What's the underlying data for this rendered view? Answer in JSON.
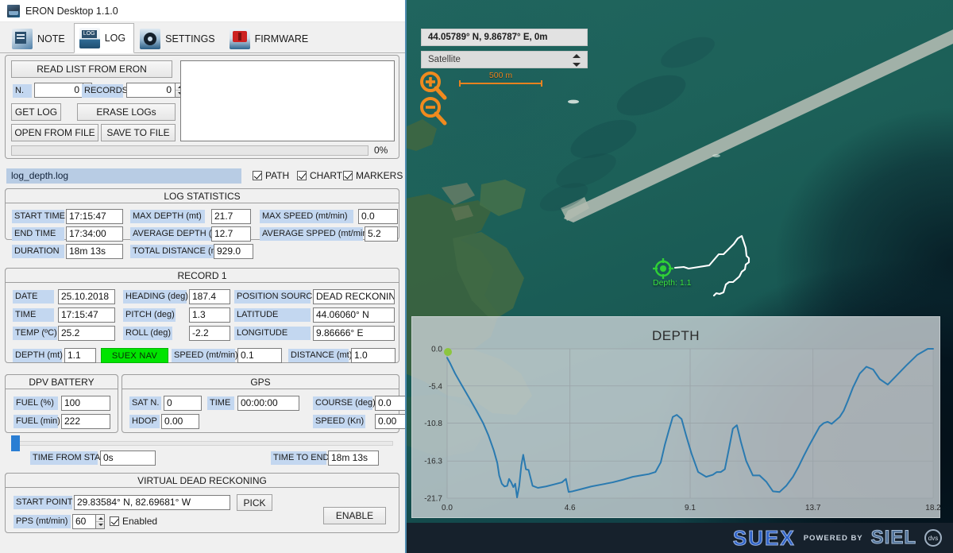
{
  "window": {
    "title": "ERON Desktop 1.1.0",
    "app_icon": "eron-app-icon",
    "minimize": "minimize-icon",
    "maximize": "maximize-icon",
    "close": "close-icon"
  },
  "tabs": [
    {
      "label": "NOTE",
      "icon": "note-icon",
      "active": false
    },
    {
      "label": "LOG",
      "icon": "log-icon",
      "active": true
    },
    {
      "label": "SETTINGS",
      "icon": "gear-icon",
      "active": false
    },
    {
      "label": "FIRMWARE",
      "icon": "firmware-icon",
      "active": false
    }
  ],
  "log_controls": {
    "read_list_button": "READ LIST FROM ERON",
    "n_label": "N.",
    "n_value": "0",
    "records_label": "RECORDS",
    "records_value": "0",
    "get_log_button": "GET LOG",
    "erase_logs_button": "ERASE LOGs",
    "open_from_file_button": "OPEN FROM FILE",
    "save_to_file_button": "SAVE TO FILE",
    "progress_percent": "0%",
    "progress_value": 0,
    "log_list_items": []
  },
  "file_row": {
    "filename": "log_depth.log",
    "checkboxes": [
      {
        "label": "PATH",
        "checked": true
      },
      {
        "label": "CHART",
        "checked": true
      },
      {
        "label": "MARKERS",
        "checked": true
      }
    ]
  },
  "log_statistics": {
    "title": "LOG STATISTICS",
    "fields": [
      {
        "label": "START TIME",
        "value": "17:15:47"
      },
      {
        "label": "END TIME",
        "value": "17:34:00"
      },
      {
        "label": "DURATION",
        "value": "18m 13s"
      },
      {
        "label": "MAX DEPTH (mt)",
        "value": "21.7"
      },
      {
        "label": "AVERAGE DEPTH (mt)",
        "value": "12.7"
      },
      {
        "label": "TOTAL DISTANCE (mt)",
        "value": "929.0"
      },
      {
        "label": "MAX SPEED (mt/min)",
        "value": "0.0"
      },
      {
        "label": "AVERAGE SPPED (mt/min)",
        "value": "5.2"
      }
    ]
  },
  "record": {
    "title": "RECORD  1",
    "date_label": "DATE",
    "date_value": "25.10.2018",
    "time_label": "TIME",
    "time_value": "17:15:47",
    "temp_label": "TEMP (ºC)",
    "temp_value": "25.2",
    "heading_label": "HEADING (deg)",
    "heading_value": "187.4",
    "pitch_label": "PITCH (deg)",
    "pitch_value": "1.3",
    "roll_label": "ROLL (deg)",
    "roll_value": "-2.2",
    "position_source_label": "POSITION SOURCE",
    "position_source_value": "DEAD RECKONING",
    "latitude_label": "LATITUDE",
    "latitude_value": "44.06060° N",
    "longitude_label": "LONGITUDE",
    "longitude_value": "9.86666° E",
    "depth_label": "DEPTH (mt)",
    "depth_value": "1.1",
    "nav_badge": "SUEX NAV",
    "speed_label": "SPEED (mt/min)",
    "speed_value": "0.1",
    "distance_label": "DISTANCE (mt)",
    "distance_value": "1.0"
  },
  "dpv_battery": {
    "title": "DPV BATTERY",
    "fuel_pct_label": "FUEL (%)",
    "fuel_pct_value": "100",
    "fuel_min_label": "FUEL (min)",
    "fuel_min_value": "222"
  },
  "gps": {
    "title": "GPS",
    "sat_label": "SAT N.",
    "sat_value": "0",
    "hdop_label": "HDOP",
    "hdop_value": "0.00",
    "time_label": "TIME",
    "time_value": "00:00:00",
    "course_label": "COURSE (deg)",
    "course_value": "0.0",
    "speed_label": "SPEED (Kn)",
    "speed_value": "0.00"
  },
  "timeline": {
    "position": 0,
    "time_from_start_label": "TIME FROM START",
    "time_from_start_value": "0s",
    "time_to_end_label": "TIME TO END",
    "time_to_end_value": "18m 13s"
  },
  "virtual_dead_reckoning": {
    "title": "VIRTUAL DEAD RECKONING",
    "start_point_label": "START POINT",
    "start_point_value": "29.83584° N, 82.69681° W",
    "pick_button": "PICK",
    "pps_label": "PPS  (mt/min)",
    "pps_value": "60",
    "enabled_label": "Enabled",
    "enabled_checked": true,
    "enable_button": "ENABLE"
  },
  "map": {
    "coords": "44.05789° N, 9.86787° E, 0m",
    "layer": "Satellite",
    "zoom_in_icon": "zoom-in-icon",
    "zoom_out_icon": "zoom-out-icon",
    "scale_label": "500 m",
    "marker_label": "Depth: 1.1",
    "track_color": "#ffffff",
    "marker_color": "#39e23f"
  },
  "brand": {
    "suex": "SUEX",
    "powered_by": "POWERED BY",
    "siel": "SIEL",
    "dot": "dvs"
  },
  "chart_data": {
    "type": "line",
    "title": "DEPTH",
    "xlabel": "",
    "ylabel": "",
    "line_color": "#2a7ab0",
    "grid": true,
    "legend": false,
    "xlim": [
      0.0,
      18.2
    ],
    "ylim": [
      -21.7,
      0.0
    ],
    "xticks": [
      0.0,
      4.6,
      9.1,
      13.7,
      18.2
    ],
    "xtick_labels": [
      "0.0",
      "4.6",
      "9.1",
      "13.7",
      "18.2"
    ],
    "yticks": [
      0.0,
      -5.4,
      -10.8,
      -16.3,
      -21.7
    ],
    "ytick_labels": [
      "0.0",
      "-5.4",
      "-10.8",
      "-16.3",
      "-21.7"
    ],
    "start_marker": {
      "x": 0.0,
      "y": 0.0,
      "color": "#8cc63f"
    },
    "series": [
      {
        "name": "Depth (mt)",
        "x": [
          0.0,
          0.1,
          0.3,
          0.55,
          0.85,
          1.1,
          1.35,
          1.55,
          1.75,
          1.88,
          1.95,
          2.05,
          2.15,
          2.25,
          2.32,
          2.4,
          2.48,
          2.55,
          2.62,
          2.7,
          2.78,
          2.85,
          2.95,
          3.05,
          3.2,
          3.4,
          3.7,
          4.0,
          4.3,
          4.45,
          4.55,
          4.7,
          5.0,
          5.4,
          5.8,
          6.2,
          6.6,
          6.95,
          7.25,
          7.55,
          7.8,
          8.0,
          8.15,
          8.3,
          8.45,
          8.6,
          8.78,
          8.95,
          9.15,
          9.4,
          9.7,
          9.95,
          10.1,
          10.25,
          10.4,
          10.55,
          10.7,
          10.85,
          11.0,
          11.2,
          11.45,
          11.7,
          11.95,
          12.2,
          12.45,
          12.7,
          12.95,
          13.15,
          13.35,
          13.55,
          13.75,
          13.95,
          14.1,
          14.25,
          14.4,
          14.55,
          14.7,
          14.85,
          15.0,
          15.2,
          15.45,
          15.7,
          15.95,
          16.2,
          16.5,
          16.8,
          17.2,
          17.6,
          18.0,
          18.2
        ],
        "y": [
          -1.3,
          -2.0,
          -3.6,
          -5.3,
          -7.3,
          -9.0,
          -10.8,
          -12.6,
          -14.8,
          -16.6,
          -18.4,
          -19.6,
          -20.0,
          -19.9,
          -18.9,
          -19.4,
          -20.1,
          -19.6,
          -21.6,
          -19.9,
          -16.9,
          -15.4,
          -17.5,
          -17.6,
          -19.9,
          -20.2,
          -20.0,
          -19.7,
          -19.4,
          -18.9,
          -20.8,
          -20.7,
          -20.4,
          -20.0,
          -19.7,
          -19.4,
          -19.0,
          -18.6,
          -18.4,
          -18.2,
          -17.9,
          -16.5,
          -14.0,
          -11.9,
          -9.9,
          -9.6,
          -10.2,
          -12.6,
          -15.2,
          -17.9,
          -18.6,
          -18.3,
          -17.9,
          -17.9,
          -17.5,
          -14.6,
          -11.6,
          -11.1,
          -13.5,
          -16.3,
          -18.4,
          -18.4,
          -19.3,
          -20.7,
          -20.8,
          -19.9,
          -18.6,
          -17.2,
          -15.6,
          -14.1,
          -12.7,
          -11.3,
          -10.8,
          -10.6,
          -10.9,
          -10.4,
          -9.9,
          -9.0,
          -7.6,
          -5.6,
          -3.6,
          -2.6,
          -3.0,
          -4.4,
          -5.2,
          -4.0,
          -2.4,
          -0.9,
          0.0,
          0.0
        ]
      }
    ]
  }
}
